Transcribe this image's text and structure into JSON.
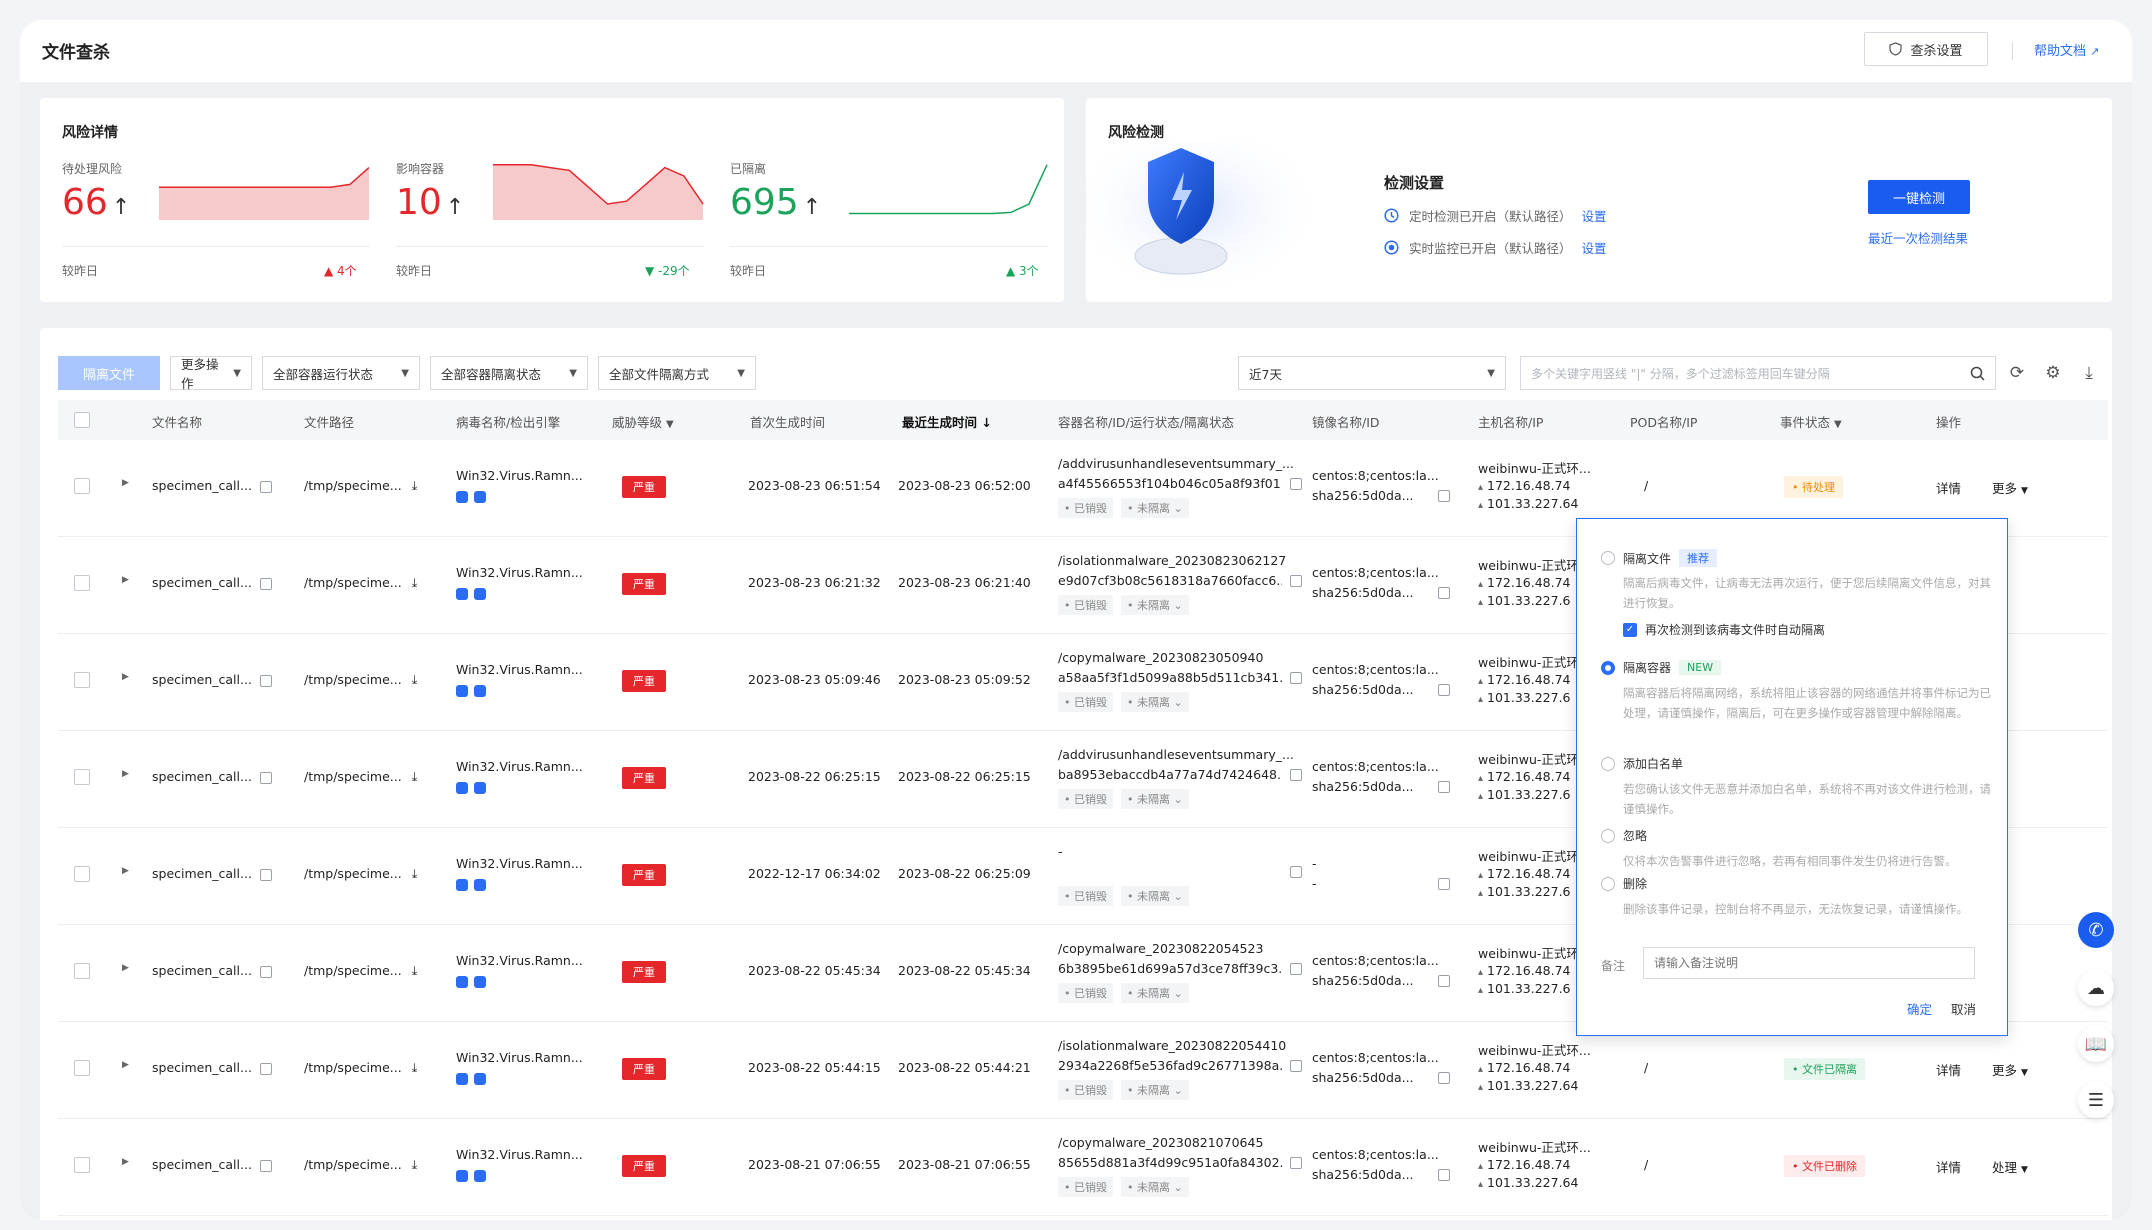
{
  "header": {
    "title": "文件查杀",
    "settings_btn": "查杀设置",
    "help_link": "帮助文档"
  },
  "risk": {
    "title": "风险详情",
    "metrics": [
      {
        "label": "待处理风险",
        "value": "66",
        "foot": "较昨日",
        "delta": "▲ 4个",
        "delta_color": "#e5262b",
        "color": "#e5262b",
        "trend": [
          0.55,
          0.55,
          0.55,
          0.55,
          0.55,
          0.55,
          0.55,
          0.55,
          0.55,
          0.55,
          0.6,
          0.9
        ]
      },
      {
        "label": "影响容器",
        "value": "10",
        "foot": "较昨日",
        "delta": "▼ -29个",
        "delta_color": "#1aa35a",
        "color": "#e5262b",
        "trend": [
          0.95,
          0.95,
          0.95,
          0.9,
          0.85,
          0.55,
          0.25,
          0.3,
          0.6,
          0.9,
          0.75,
          0.25
        ]
      },
      {
        "label": "已隔离",
        "value": "695",
        "foot": "较昨日",
        "delta": "▲ 3个",
        "delta_color": "#1aa35a",
        "color": "#1aa35a",
        "trend": [
          0.08,
          0.08,
          0.08,
          0.08,
          0.08,
          0.08,
          0.08,
          0.08,
          0.08,
          0.1,
          0.25,
          0.95
        ]
      }
    ]
  },
  "detect": {
    "title": "风险检测",
    "setting_title": "检测设置",
    "rows": [
      {
        "icon": "clock-icon",
        "text": "定时检测已开启（默认路径）",
        "link": "设置"
      },
      {
        "icon": "monitor-icon",
        "text": "实时监控已开启（默认路径）",
        "link": "设置"
      }
    ],
    "scan_btn": "一键检测",
    "last_result": "最近一次检测结果"
  },
  "toolbar": {
    "isolate_btn": "隔离文件",
    "more_ops": "更多操作",
    "container_run": "全部容器运行状态",
    "container_isolate": "全部容器隔离状态",
    "file_isolate": "全部文件隔离方式",
    "time_range": "近7天",
    "search_placeholder": "多个关键字用竖线 \"|\" 分隔，多个过滤标签用回车键分隔"
  },
  "columns": [
    "文件名称",
    "文件路径",
    "病毒名称/检出引擎",
    "威胁等级",
    "首次生成时间",
    "最近生成时间",
    "容器名称/ID/运行状态/隔离状态",
    "镜像名称/ID",
    "主机名称/IP",
    "POD名称/IP",
    "事件状态",
    "操作"
  ],
  "rows": [
    {
      "file": "specimen_call...",
      "path": "/tmp/specime...",
      "virus": "Win32.Virus.Ramn...",
      "sev": "严重",
      "first": "2023-08-23 06:51:54",
      "last": "2023-08-23 06:52:00",
      "container": "/addvirusunhandleseventsummary_...",
      "cid": "a4f45566553f104b046c05a8f93f01...",
      "tag1": "• 已销毁",
      "tag2": "• 未隔离",
      "image": "centos:8;centos:la...",
      "imageid": "sha256:5d0da...",
      "host": "weibinwu-正式环...",
      "ip1": "172.16.48.74",
      "ip2": "101.33.227.64",
      "pod": "/",
      "status": "• 待处理",
      "status_class": "st-pending",
      "op1": "详情",
      "op2": "更多"
    },
    {
      "file": "specimen_call...",
      "path": "/tmp/specime...",
      "virus": "Win32.Virus.Ramn...",
      "sev": "严重",
      "first": "2023-08-23 06:21:32",
      "last": "2023-08-23 06:21:40",
      "container": "/isolationmalware_20230823062127",
      "cid": "e9d07cf3b08c5618318a7660facc6...",
      "tag1": "• 已销毁",
      "tag2": "• 未隔离",
      "image": "centos:8;centos:la...",
      "imageid": "sha256:5d0da...",
      "host": "weibinwu-正式环",
      "ip1": "172.16.48.74",
      "ip2": "101.33.227.6",
      "pod": "",
      "status": "",
      "status_class": "",
      "op1": "",
      "op2": ""
    },
    {
      "file": "specimen_call...",
      "path": "/tmp/specime...",
      "virus": "Win32.Virus.Ramn...",
      "sev": "严重",
      "first": "2023-08-23 05:09:46",
      "last": "2023-08-23 05:09:52",
      "container": "/copymalware_20230823050940",
      "cid": "a58aa5f3f1d5099a88b5d511cb341...",
      "tag1": "• 已销毁",
      "tag2": "• 未隔离",
      "image": "centos:8;centos:la...",
      "imageid": "sha256:5d0da...",
      "host": "weibinwu-正式环",
      "ip1": "172.16.48.74",
      "ip2": "101.33.227.6",
      "pod": "",
      "status": "",
      "status_class": "",
      "op1": "",
      "op2": ""
    },
    {
      "file": "specimen_call...",
      "path": "/tmp/specime...",
      "virus": "Win32.Virus.Ramn...",
      "sev": "严重",
      "first": "2023-08-22 06:25:15",
      "last": "2023-08-22 06:25:15",
      "container": "/addvirusunhandleseventsummary_...",
      "cid": "ba8953ebaccdb4a77a74d7424648...",
      "tag1": "• 已销毁",
      "tag2": "• 未隔离",
      "image": "centos:8;centos:la...",
      "imageid": "sha256:5d0da...",
      "host": "weibinwu-正式环",
      "ip1": "172.16.48.74",
      "ip2": "101.33.227.6",
      "pod": "",
      "status": "",
      "status_class": "",
      "op1": "",
      "op2": ""
    },
    {
      "file": "specimen_call...",
      "path": "/tmp/specime...",
      "virus": "Win32.Virus.Ramn...",
      "sev": "严重",
      "first": "2022-12-17 06:34:02",
      "last": "2023-08-22 06:25:09",
      "container": "-",
      "cid": "",
      "tag1": "• 已销毁",
      "tag2": "• 未隔离",
      "image": "-",
      "imageid": "-",
      "host": "weibinwu-正式环",
      "ip1": "172.16.48.74",
      "ip2": "101.33.227.6",
      "pod": "",
      "status": "",
      "status_class": "",
      "op1": "",
      "op2": ""
    },
    {
      "file": "specimen_call...",
      "path": "/tmp/specime...",
      "virus": "Win32.Virus.Ramn...",
      "sev": "严重",
      "first": "2023-08-22 05:45:34",
      "last": "2023-08-22 05:45:34",
      "container": "/copymalware_20230822054523",
      "cid": "6b3895be61d699a57d3ce78ff39c3...",
      "tag1": "• 已销毁",
      "tag2": "• 未隔离",
      "image": "centos:8;centos:la...",
      "imageid": "sha256:5d0da...",
      "host": "weibinwu-正式环",
      "ip1": "172.16.48.74",
      "ip2": "101.33.227.6",
      "pod": "",
      "status": "",
      "status_class": "",
      "op1": "",
      "op2": ""
    },
    {
      "file": "specimen_call...",
      "path": "/tmp/specime...",
      "virus": "Win32.Virus.Ramn...",
      "sev": "严重",
      "first": "2023-08-22 05:44:15",
      "last": "2023-08-22 05:44:21",
      "container": "/isolationmalware_20230822054410",
      "cid": "2934a2268f5e536fad9c26771398a...",
      "tag1": "• 已销毁",
      "tag2": "• 未隔离",
      "image": "centos:8;centos:la...",
      "imageid": "sha256:5d0da...",
      "host": "weibinwu-正式环...",
      "ip1": "172.16.48.74",
      "ip2": "101.33.227.64",
      "pod": "/",
      "status": "• 文件已隔离",
      "status_class": "st-isolated",
      "op1": "详情",
      "op2": "更多"
    },
    {
      "file": "specimen_call...",
      "path": "/tmp/specime...",
      "virus": "Win32.Virus.Ramn...",
      "sev": "严重",
      "first": "2023-08-21 07:06:55",
      "last": "2023-08-21 07:06:55",
      "container": "/copymalware_20230821070645",
      "cid": "85655d881a3f4d99c951a0fa84302...",
      "tag1": "• 已销毁",
      "tag2": "• 未隔离",
      "image": "centos:8;centos:la...",
      "imageid": "sha256:5d0da...",
      "host": "weibinwu-正式环...",
      "ip1": "172.16.48.74",
      "ip2": "101.33.227.64",
      "pod": "/",
      "status": "• 文件已删除",
      "status_class": "st-deleted",
      "op1": "详情",
      "op2": "处理"
    }
  ],
  "popup": {
    "opt1": "隔离文件",
    "opt1_badge": "推荐",
    "opt1_desc": "隔离后病毒文件，让病毒无法再次运行，便于您后续隔离文件信息，对其进行恢复。",
    "opt1_check": "再次检测到该病毒文件时自动隔离",
    "opt2": "隔离容器",
    "opt2_badge": "NEW",
    "opt2_desc": "隔离容器后将隔离网络，系统将阻止该容器的网络通信并将事件标记为已处理，请谨慎操作，隔离后，可在更多操作或容器管理中解除隔离。",
    "opt3": "添加白名单",
    "opt3_desc": "若您确认该文件无恶意并添加白名单，系统将不再对该文件进行检测，请谨慎操作。",
    "opt4": "忽略",
    "opt4_desc": "仅将本次告警事件进行忽略，若再有相同事件发生仍将进行告警。",
    "opt5": "删除",
    "opt5_desc": "删除该事件记录，控制台将不再显示，无法恢复记录，请谨慎操作。",
    "remark_label": "备注",
    "remark_placeholder": "请输入备注说明",
    "confirm": "确定",
    "cancel": "取消"
  }
}
